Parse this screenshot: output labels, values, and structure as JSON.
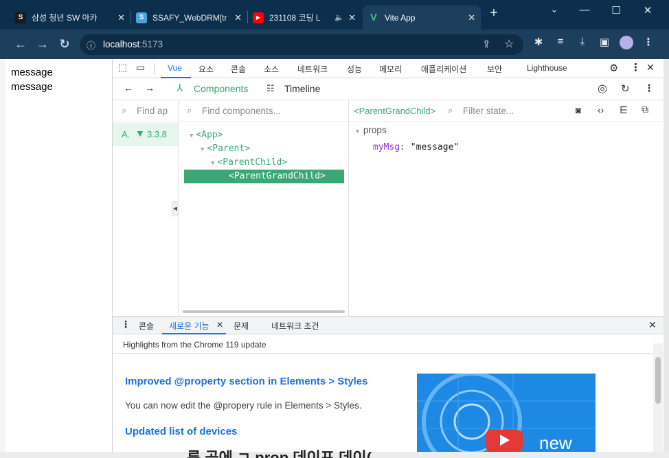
{
  "browser": {
    "tabs": [
      {
        "title": "삼성 청년 SW 아카",
        "favicon": "S",
        "favicon_color": "#1a1a1a"
      },
      {
        "title": "SSAFY_WebDRM[tr",
        "favicon": "S",
        "favicon_color": "#4aa3df"
      },
      {
        "title": "231108 코딩 L",
        "favicon": "▶",
        "favicon_color": "#ff0000",
        "audio": "🔈"
      },
      {
        "title": "Vite App",
        "favicon": "V",
        "favicon_color": "#41b883",
        "active": true
      }
    ],
    "new_tab": "+",
    "url_host": "localhost",
    "url_port": ":5173"
  },
  "page": {
    "lines": [
      "message",
      "message"
    ]
  },
  "devtools": {
    "tabs": [
      "Vue",
      "요소",
      "콘솔",
      "소스",
      "네트워크",
      "성능",
      "메모리",
      "애플리케이션",
      "보안",
      "Lighthouse"
    ],
    "vue": {
      "components_label": "Components",
      "timeline_label": "Timeline",
      "find_app_placeholder": "Find ap",
      "app_label": "A.",
      "vue_version": "3.3.8",
      "find_components_placeholder": "Find components...",
      "selected_component": "<ParentGrandChild>",
      "filter_state_placeholder": "Filter state...",
      "tree": [
        "<App>",
        "<Parent>",
        "<ParentChild>",
        "<ParentGrandChild>"
      ],
      "props_header": "props",
      "prop_key": "myMsg",
      "prop_value": "\"message\""
    },
    "drawer": {
      "tabs": [
        "콘솔",
        "새로운 기능",
        "문제",
        "네트워크 조건"
      ],
      "subtitle": "Highlights from the Chrome 119 update",
      "heading1": "Improved @property section in Elements > Styles",
      "body1": "You can now edit the @propery rule in Elements > Styles.",
      "heading2": "Updated list of devices",
      "promo_text": "new"
    }
  },
  "bottom_overlay_text": "른 곧에 ㄱ prop 데이프 데이("
}
